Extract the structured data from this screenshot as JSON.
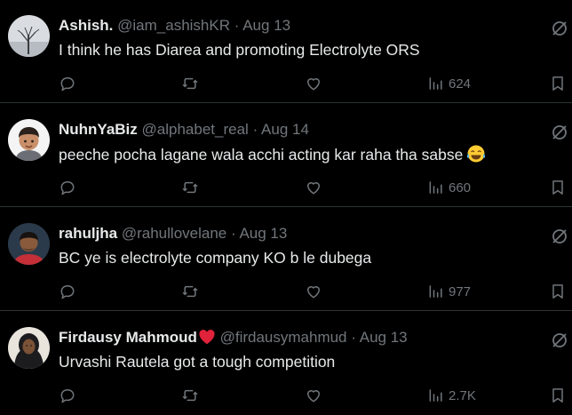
{
  "tweets": [
    {
      "name": "Ashish.",
      "handle": "@iam_ashishKR",
      "separator": "·",
      "date": "Aug 13",
      "text": "I think he has Diarea and promoting Electrolyte ORS",
      "views": "624",
      "avatar": "tree-avatar"
    },
    {
      "name": "NuhnYaBiz",
      "handle": "@alphabet_real",
      "separator": "·",
      "date": "Aug 14",
      "text": "peeche pocha lagane wala acchi acting kar raha tha sabse",
      "emoji": "tears-of-joy-emoji",
      "views": "660",
      "avatar": "memoji-avatar"
    },
    {
      "name": "rahuljha",
      "handle": "@rahullovelane",
      "separator": "·",
      "date": "Aug 13",
      "text": "BC ye is electrolyte company KO b le dubega",
      "views": "977",
      "avatar": "photo-avatar"
    },
    {
      "name": "Firdausy Mahmoud",
      "name_badge": "red-heart-icon",
      "handle": "@firdausymahmud",
      "separator": "·",
      "date": "Aug 13",
      "text": "Urvashi Rautela got a tough competition",
      "views": "2.7K",
      "avatar": "hijab-avatar"
    }
  ],
  "icons": {
    "reply": "reply-icon",
    "repost": "repost-icon",
    "like": "like-icon",
    "views": "views-icon",
    "bookmark": "bookmark-icon",
    "more": "grok-slash-icon"
  },
  "colors": {
    "background": "#000000",
    "text": "#e7e9ea",
    "muted": "#71767b",
    "divider": "#2f3336",
    "heart": "#f91880"
  }
}
